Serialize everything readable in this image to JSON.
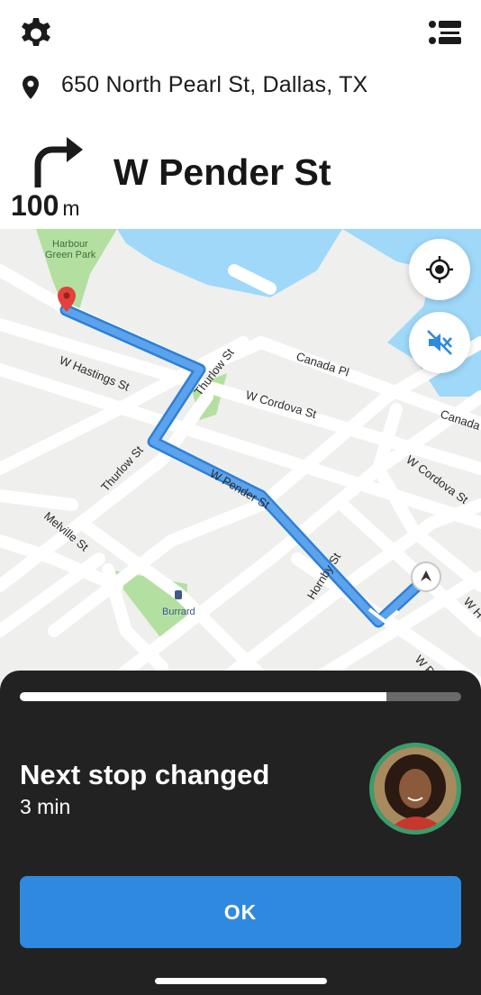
{
  "header": {
    "settings_icon": "gear-icon",
    "list_icon": "list-icon",
    "address_icon": "map-pin-icon",
    "address": "650 North Pearl St, Dallas, TX"
  },
  "navigation": {
    "turn_icon": "turn-right-arrow-icon",
    "distance_value": "100",
    "distance_unit": "m",
    "street": "W Pender St"
  },
  "map": {
    "labels": {
      "park": "Harbour",
      "park_line2": "Green Park",
      "w_hastings": "W Hastings St",
      "thurlow_upper": "Thurlow St",
      "canada_pl": "Canada Pl",
      "w_cordova": "W Cordova St",
      "canada_right": "Canada",
      "thurlow_lower": "Thurlow St",
      "w_pender": "W Pender St",
      "w_cordova_right": "W Cordova St",
      "melville": "Melville St",
      "burrard": "Burrard",
      "hornby": "Hornby St",
      "edge_label_1": "W H",
      "edge_label_2": "W P"
    },
    "colors": {
      "route": "#4a90e2",
      "water": "#9fd8f8",
      "park": "#b3e0a0",
      "road": "#ffffff",
      "background": "#efefed"
    },
    "controls": {
      "locate_icon": "crosshair-icon",
      "mute_icon": "muted-speaker-icon"
    }
  },
  "notice": {
    "progress": 0.83,
    "title": "Next stop changed",
    "subtitle": "3 min",
    "avatar": "avatar",
    "ok_label": "OK"
  },
  "colors": {
    "sheet_bg": "#222222",
    "button_blue": "#2f89de",
    "avatar_ring": "#3d9c6b"
  }
}
